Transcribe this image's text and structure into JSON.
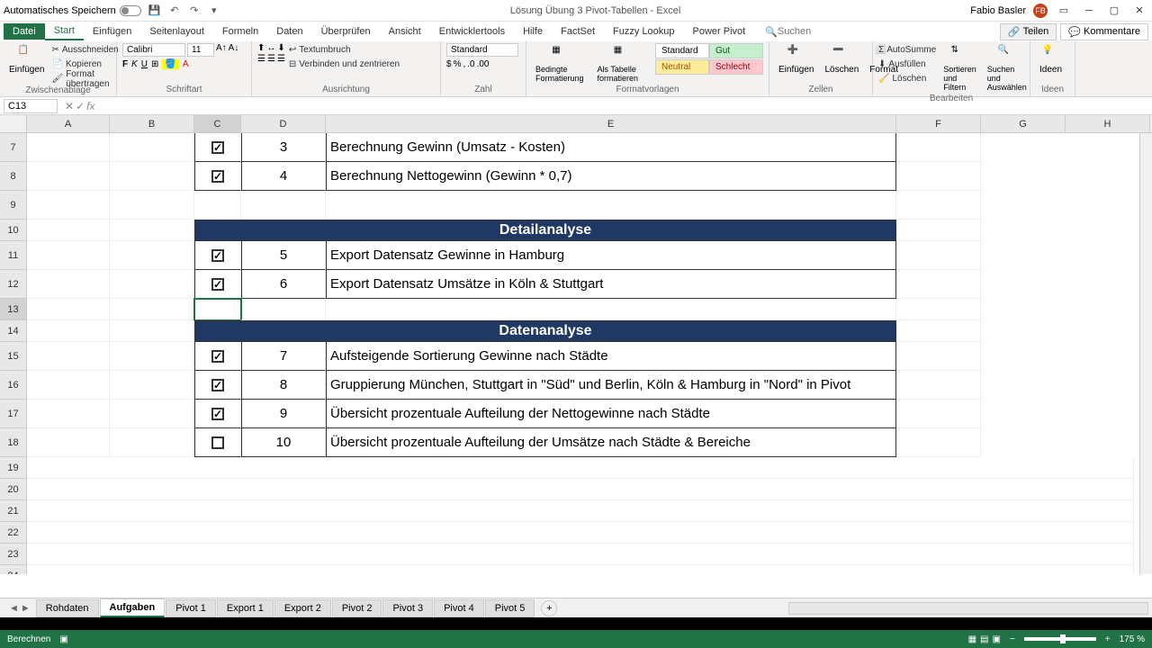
{
  "titlebar": {
    "autosave": "Automatisches Speichern",
    "filename": "Lösung Übung 3 Pivot-Tabellen - Excel",
    "username": "Fabio Basler",
    "user_initials": "FB"
  },
  "ribbon": {
    "file": "Datei",
    "tabs": [
      "Start",
      "Einfügen",
      "Seitenlayout",
      "Formeln",
      "Daten",
      "Überprüfen",
      "Ansicht",
      "Entwicklertools",
      "Hilfe",
      "FactSet",
      "Fuzzy Lookup",
      "Power Pivot"
    ],
    "search_placeholder": "Suchen",
    "share": "Teilen",
    "comments": "Kommentare",
    "clipboard": {
      "paste": "Einfügen",
      "cut": "Ausschneiden",
      "copy": "Kopieren",
      "format_painter": "Format übertragen",
      "label": "Zwischenablage"
    },
    "font": {
      "name": "Calibri",
      "size": "11",
      "label": "Schriftart"
    },
    "alignment": {
      "wrap": "Textumbruch",
      "merge": "Verbinden und zentrieren",
      "label": "Ausrichtung"
    },
    "number": {
      "format": "Standard",
      "label": "Zahl"
    },
    "styles": {
      "conditional": "Bedingte Formatierung",
      "table": "Als Tabelle formatieren",
      "standard": "Standard",
      "gut": "Gut",
      "neutral": "Neutral",
      "schlecht": "Schlecht",
      "label": "Formatvorlagen"
    },
    "cells": {
      "insert": "Einfügen",
      "delete": "Löschen",
      "format": "Format",
      "label": "Zellen"
    },
    "editing": {
      "autosum": "AutoSumme",
      "fill": "Ausfüllen",
      "clear": "Löschen",
      "sort": "Sortieren und Filtern",
      "find": "Suchen und Auswählen",
      "label": "Bearbeiten"
    },
    "ideas": {
      "btn": "Ideen",
      "label": "Ideen"
    }
  },
  "namebox": "C13",
  "columns": [
    "A",
    "B",
    "C",
    "D",
    "E",
    "F",
    "G",
    "H"
  ],
  "rows": {
    "7": {
      "num": "3",
      "text": "Berechnung Gewinn (Umsatz - Kosten)",
      "checked": true
    },
    "8": {
      "num": "4",
      "text": "Berechnung Nettogewinn (Gewinn * 0,7)",
      "checked": true
    },
    "10": {
      "header": "Detailanalyse"
    },
    "11": {
      "num": "5",
      "text": "Export Datensatz Gewinne in Hamburg",
      "checked": true
    },
    "12": {
      "num": "6",
      "text": "Export Datensatz Umsätze in Köln & Stuttgart",
      "checked": true
    },
    "14": {
      "header": "Datenanalyse"
    },
    "15": {
      "num": "7",
      "text": "Aufsteigende Sortierung Gewinne nach Städte",
      "checked": true
    },
    "16": {
      "num": "8",
      "text": "Gruppierung München, Stuttgart in \"Süd\" und Berlin, Köln & Hamburg in \"Nord\" in Pivot",
      "checked": true
    },
    "17": {
      "num": "9",
      "text": "Übersicht prozentuale Aufteilung der Nettogewinne nach Städte",
      "checked": true
    },
    "18": {
      "num": "10",
      "text": "Übersicht prozentuale Aufteilung der Umsätze nach Städte & Bereiche",
      "checked": false
    }
  },
  "sheets": [
    "Rohdaten",
    "Aufgaben",
    "Pivot 1",
    "Export 1",
    "Export 2",
    "Pivot 2",
    "Pivot 3",
    "Pivot 4",
    "Pivot 5"
  ],
  "active_sheet": "Aufgaben",
  "statusbar": {
    "status": "Berechnen",
    "zoom": "175 %"
  }
}
